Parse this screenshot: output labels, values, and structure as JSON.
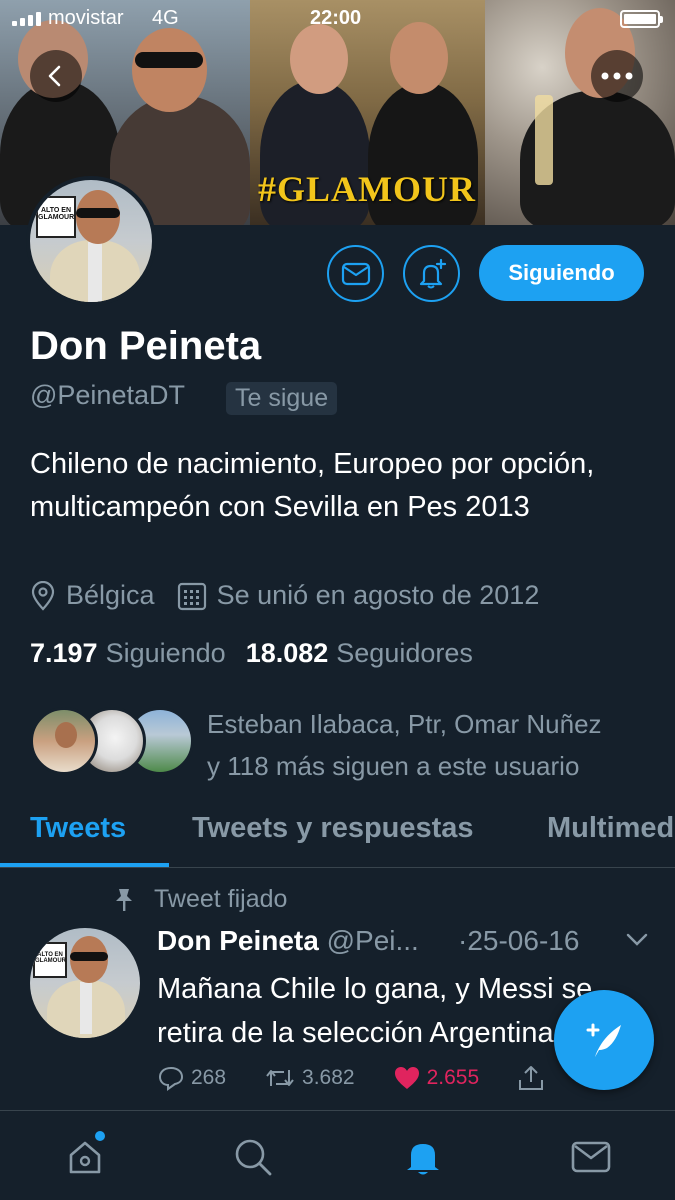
{
  "status_bar": {
    "carrier": "movistar",
    "network": "4G",
    "time": "22:00"
  },
  "banner": {
    "text": "#GLAMOUR"
  },
  "avatar": {
    "sign_line1": "ALTO EN",
    "sign_line2": "GLAMOUR"
  },
  "profile": {
    "name": "Don Peineta",
    "handle": "@PeinetaDT",
    "follows_you": "Te sigue",
    "bio": "Chileno de nacimiento, Europeo por opción, multicampeón con Sevilla en Pes 2013",
    "location": "Bélgica",
    "joined": "Se unió en agosto de 2012",
    "following_count": "7.197",
    "following_label": "Siguiendo",
    "followers_count": "18.082",
    "followers_label": "Seguidores"
  },
  "actions": {
    "follow_label": "Siguiendo"
  },
  "followers_you_know": {
    "line1": "Esteban Ilabaca, Ptr, Omar Nuñez",
    "line2": "y 118 más siguen a este usuario"
  },
  "tabs": [
    {
      "label": "Tweets",
      "active": true
    },
    {
      "label": "Tweets y respuestas",
      "active": false
    },
    {
      "label": "Multimedia",
      "active": false
    }
  ],
  "tweet": {
    "pinned_label": "Tweet fijado",
    "name": "Don Peineta",
    "handle": "@Pei...",
    "date": "·25-06-16",
    "text": "Mañana Chile lo gana, y Messi se retira de la selección Argentina",
    "replies": "268",
    "retweets": "3.682",
    "likes": "2.655"
  },
  "colors": {
    "accent": "#1da1f2",
    "background": "#15202b",
    "muted": "#8899a6",
    "like": "#e0245e",
    "banner_text": "#f2c51b"
  },
  "icons": [
    "back-arrow-icon",
    "more-dots-icon",
    "mail-icon",
    "bell-plus-icon",
    "location-pin-icon",
    "calendar-icon",
    "pin-icon",
    "reply-icon",
    "retweet-icon",
    "heart-icon",
    "share-icon",
    "compose-icon",
    "home-icon",
    "search-icon",
    "notifications-icon",
    "messages-icon"
  ]
}
